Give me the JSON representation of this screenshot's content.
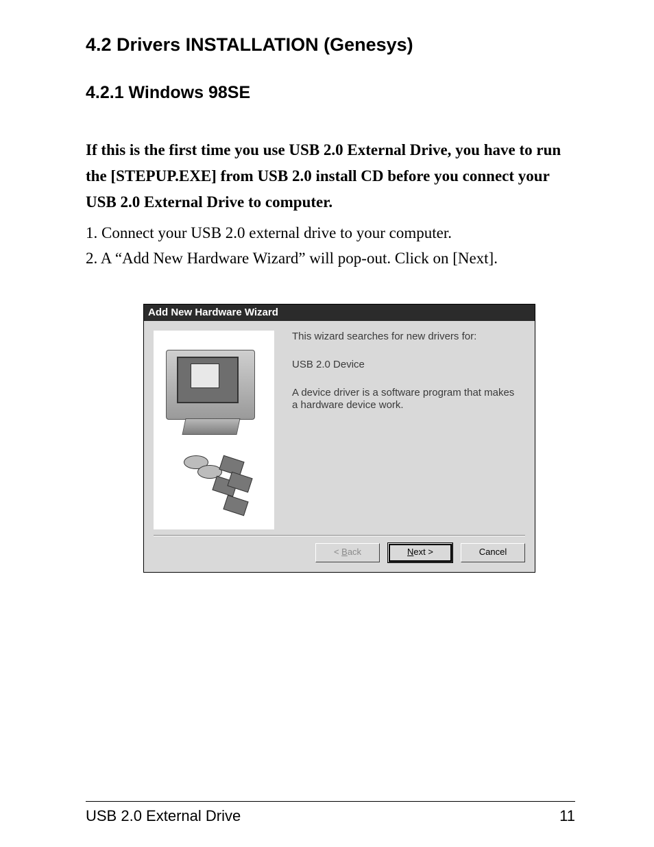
{
  "heading_1": "4.2 Drivers INSTALLATION (Genesys)",
  "heading_2": "4.2.1 Windows 98SE",
  "intro_bold": "If this is the first time you use USB 2.0 External Drive, you have to run the [STEPUP.EXE] from USB 2.0 install CD before you connect your USB 2.0 External Drive to computer.",
  "steps": [
    "1. Connect your USB 2.0 external drive to your computer.",
    "2. A “Add New Hardware Wizard” will pop-out. Click on [Next]."
  ],
  "dialog": {
    "title": "Add New Hardware Wizard",
    "line1": "This wizard searches for new drivers for:",
    "device": "USB 2.0 Device",
    "line2": "A device driver is a software program that makes a hardware device work.",
    "buttons": {
      "back_prefix": "< ",
      "back_u": "B",
      "back_suffix": "ack",
      "next_u": "N",
      "next_suffix": "ext >",
      "cancel": "Cancel"
    }
  },
  "footer": {
    "left": "USB 2.0 External Drive",
    "right": "11"
  }
}
